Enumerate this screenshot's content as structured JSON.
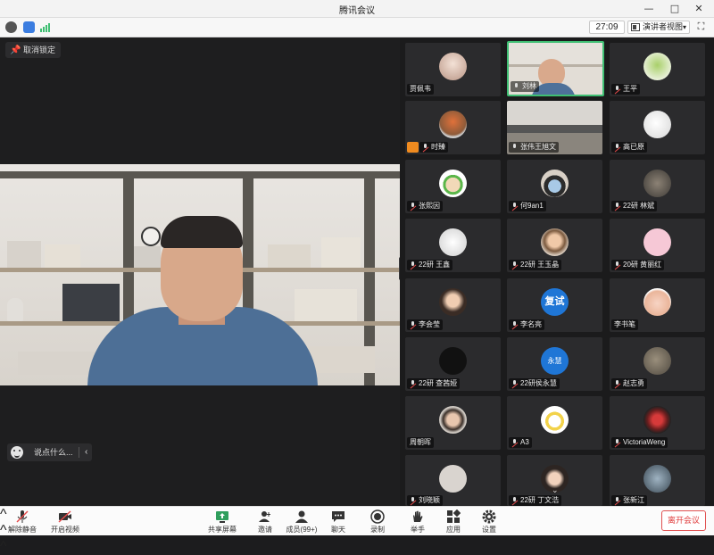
{
  "app": {
    "title": "腾讯会议",
    "window_controls": {
      "minimize": "—",
      "maximize": "□",
      "close": "✕"
    }
  },
  "infobar": {
    "timer": "27:09",
    "view_mode": "演讲者视图",
    "icons": [
      "info-icon",
      "shield-icon",
      "signal-icon",
      "fullscreen-icon"
    ]
  },
  "main": {
    "unlock_label": "取消锁定",
    "chat_placeholder": "说点什么..."
  },
  "participants": [
    {
      "name": "贾佩韦"
    },
    {
      "name": "刘林"
    },
    {
      "name": "王平"
    },
    {
      "name": "时臻"
    },
    {
      "name": "张伟王旭文"
    },
    {
      "name": "高已原"
    },
    {
      "name": "张熙因"
    },
    {
      "name": "何9an1"
    },
    {
      "name": "22研 林斌"
    },
    {
      "name": "22研 王鑫"
    },
    {
      "name": "22研 王玉晶"
    },
    {
      "name": "20研 黄丽红"
    },
    {
      "name": "李会莹"
    },
    {
      "name": "李名亮"
    },
    {
      "name": "李书笔"
    },
    {
      "name": "22研 查茜娅"
    },
    {
      "name": "22研侯永慧"
    },
    {
      "name": "赵志勇"
    },
    {
      "name": "周朝晖"
    },
    {
      "name": "A3"
    },
    {
      "name": "VictoriaWeng"
    },
    {
      "name": "刘晓颖"
    },
    {
      "name": "22研 丁文浩"
    },
    {
      "name": "张新江"
    }
  ],
  "avatar_badges": {
    "fushi": "复试",
    "yongzhi": "永慧"
  },
  "toolbar": {
    "unmute": "解除静音",
    "start_video": "开启视频",
    "share_screen": "共享屏幕",
    "invite": "邀请",
    "members": "成员(99+)",
    "chat": "聊天",
    "record": "录制",
    "raise_hand": "举手",
    "apps": "应用",
    "settings": "设置",
    "leave": "离开会议"
  },
  "colors": {
    "accent_green": "#3fbf73",
    "leave_red": "#e03c3c",
    "mute_red": "#e64b4b"
  }
}
